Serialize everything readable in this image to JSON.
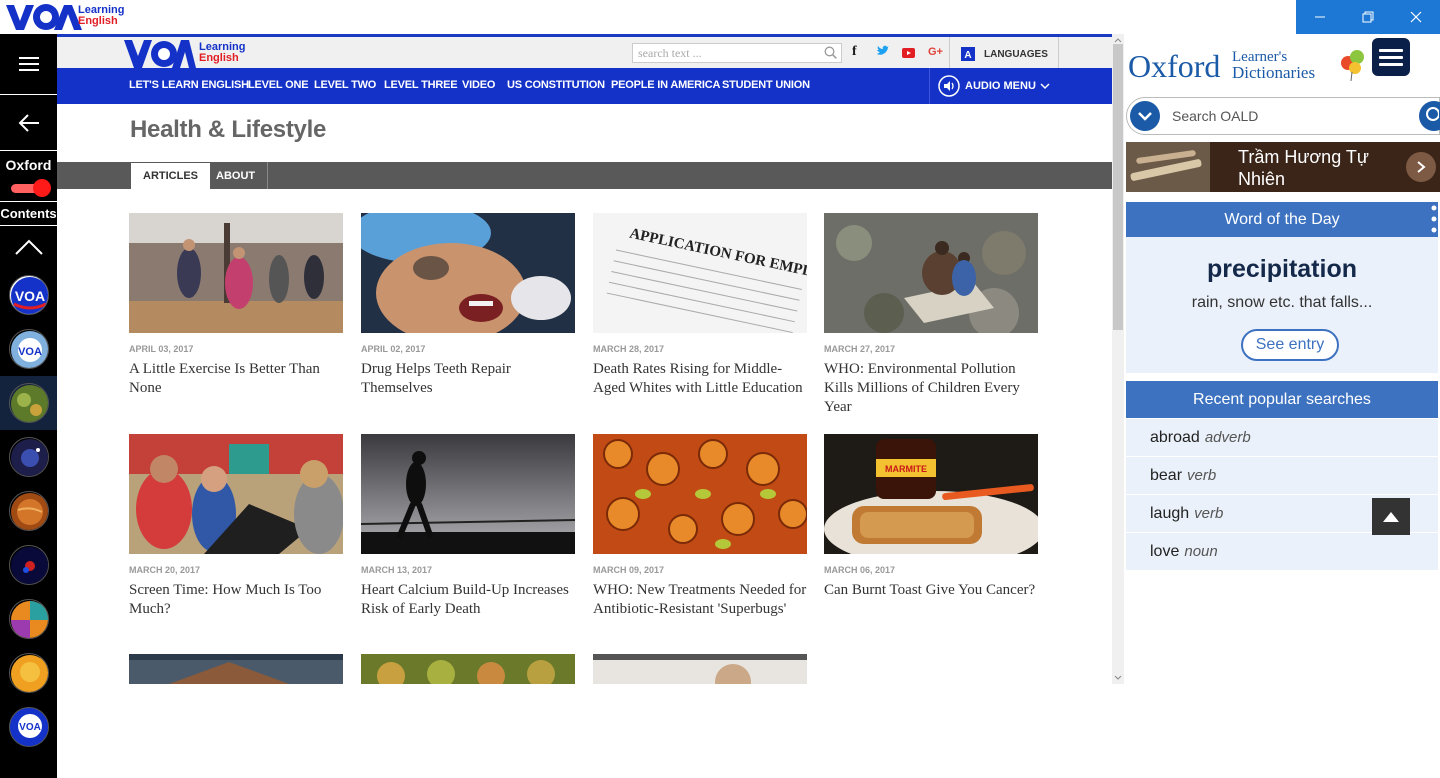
{
  "titlebar": {
    "logo_text": "VOA",
    "logo_sub1": "Learning",
    "logo_sub2": "English"
  },
  "rail": {
    "oxford_label": "Oxford",
    "contents_label": "Contents"
  },
  "voa": {
    "logo_text": "VOA",
    "logo_sub1": "Learning",
    "logo_sub2": "English",
    "search_placeholder": "search text ...",
    "languages_label": "LANGUAGES",
    "nav": [
      "LET'S LEARN ENGLISH",
      "LEVEL ONE",
      "LEVEL TWO",
      "LEVEL THREE",
      "VIDEO",
      "US CONSTITUTION",
      "PEOPLE IN AMERICA",
      "STUDENT UNION"
    ],
    "audio_menu": "AUDIO MENU",
    "page_title": "Health & Lifestyle",
    "tabs": [
      "ARTICLES",
      "ABOUT"
    ],
    "articles": [
      {
        "date": "APRIL 03, 2017",
        "title": "A Little Exercise Is Better Than None"
      },
      {
        "date": "APRIL 02, 2017",
        "title": "Drug Helps Teeth Repair Themselves"
      },
      {
        "date": "MARCH 28, 2017",
        "title": "Death Rates Rising for Middle-Aged Whites with Little Education"
      },
      {
        "date": "MARCH 27, 2017",
        "title": "WHO: Environmental Pollution Kills Millions of Children Every Year"
      },
      {
        "date": "MARCH 20, 2017",
        "title": "Screen Time: How Much Is Too Much?"
      },
      {
        "date": "MARCH 13, 2017",
        "title": "Heart Calcium Build-Up Increases Risk of Early Death"
      },
      {
        "date": "MARCH 09, 2017",
        "title": "WHO: New Treatments Needed for Antibiotic-Resistant 'Superbugs'"
      },
      {
        "date": "MARCH 06, 2017",
        "title": "Can Burnt Toast Give You Cancer?"
      }
    ]
  },
  "oxford": {
    "brand": "Oxford",
    "sub1": "Learner's",
    "sub2": "Dictionaries",
    "search_placeholder": "Search OALD",
    "ad_line1": "Trầm Hương Tự",
    "ad_line2": "Nhiên",
    "wotd_header": "Word of the Day",
    "wotd_word": "precipitation",
    "wotd_def": "rain, snow etc. that falls...",
    "see_entry": "See entry",
    "recent_header": "Recent popular searches",
    "recent": [
      {
        "word": "abroad",
        "pos": "adverb"
      },
      {
        "word": "bear",
        "pos": "verb"
      },
      {
        "word": "laugh",
        "pos": "verb"
      },
      {
        "word": "love",
        "pos": "noun"
      }
    ]
  },
  "colors": {
    "voa_blue": "#1432c8",
    "oxford_blue": "#3d72c0",
    "oxford_navy": "#0b2048"
  }
}
